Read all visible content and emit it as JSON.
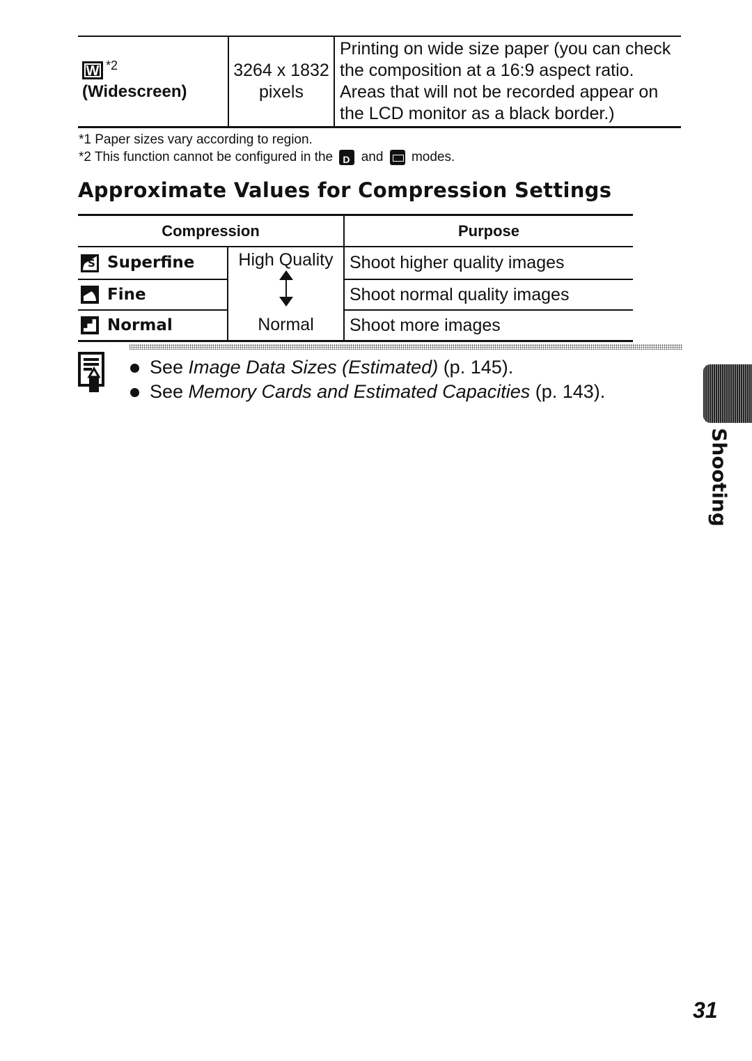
{
  "top_table": {
    "row": {
      "icon": "widescreen-w-icon",
      "icon_letter": "W",
      "footnote_ref": "*2",
      "label": "(Widescreen)",
      "resolution_line1": "3264 x 1832",
      "resolution_line2": "pixels",
      "description_lines": [
        "Printing on wide size paper (you can check",
        "the composition at a 16:9 aspect ratio.",
        "Areas that will not be recorded appear on",
        "the LCD monitor as a black border.)"
      ]
    }
  },
  "footnotes": {
    "note1": "*1 Paper sizes vary according to region.",
    "note2_before": "*2 This function cannot be configured in the",
    "note2_mid": "and",
    "note2_after": "modes.",
    "icons": [
      "digital-macro-mode-icon",
      "stitch-assist-mode-icon"
    ]
  },
  "heading": "Approximate Values for Compression Settings",
  "compression_table": {
    "headers": [
      "Compression",
      "Purpose"
    ],
    "rows": [
      {
        "icon": "superfine-icon",
        "name": "Superfine",
        "purpose": "Shoot higher quality images"
      },
      {
        "icon": "fine-icon",
        "name": "Fine",
        "purpose": "Shoot normal quality images"
      },
      {
        "icon": "normal-icon",
        "name": "Normal",
        "purpose": "Shoot more images"
      }
    ],
    "quality_top": "High Quality",
    "quality_bottom": "Normal"
  },
  "memo": {
    "icon": "memo-icon",
    "items": [
      {
        "prefix": "See ",
        "title": "Image Data Sizes (Estimated)",
        "suffix": " (p. 145)."
      },
      {
        "prefix": "See ",
        "title": "Memory Cards and Estimated Capacities",
        "suffix": " (p. 143)."
      }
    ]
  },
  "side_tab": {
    "label": "Shooting"
  },
  "page_number": "31"
}
